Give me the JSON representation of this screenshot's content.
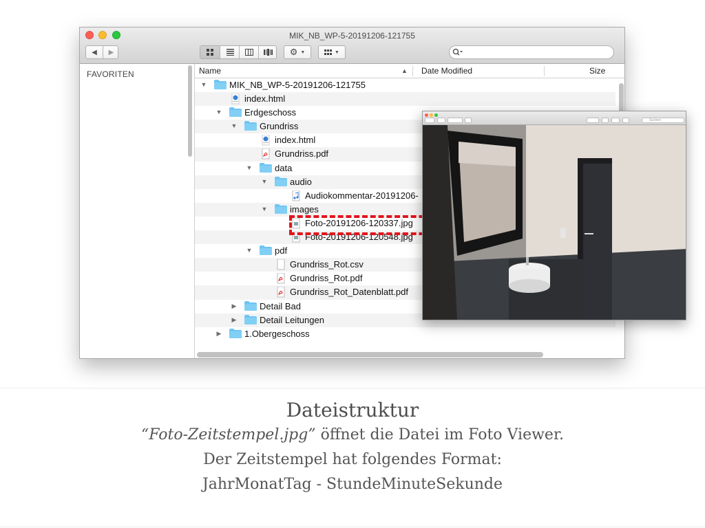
{
  "window": {
    "title": "MIK_NB_WP-5-20191206-121755",
    "search_placeholder": ""
  },
  "sidebar": {
    "heading": "FAVORITEN"
  },
  "columns": {
    "name": "Name",
    "date_modified": "Date Modified",
    "size": "Size"
  },
  "files": [
    {
      "name": "MIK_NB_WP-5-20191206-121755",
      "level": 0,
      "kind": "folder",
      "disclosure": "open"
    },
    {
      "name": "index.html",
      "level": 1,
      "kind": "html",
      "disclosure": "none"
    },
    {
      "name": "Erdgeschoss",
      "level": 1,
      "kind": "folder",
      "disclosure": "open"
    },
    {
      "name": "Grundriss",
      "level": 2,
      "kind": "folder",
      "disclosure": "open"
    },
    {
      "name": "index.html",
      "level": 3,
      "kind": "html",
      "disclosure": "none"
    },
    {
      "name": "Grundriss.pdf",
      "level": 3,
      "kind": "pdf",
      "disclosure": "none"
    },
    {
      "name": "data",
      "level": 3,
      "kind": "folder",
      "disclosure": "open"
    },
    {
      "name": "audio",
      "level": 4,
      "kind": "folder",
      "disclosure": "open"
    },
    {
      "name": "Audiokommentar-20191206-",
      "level": 5,
      "kind": "audio",
      "disclosure": "none"
    },
    {
      "name": "images",
      "level": 4,
      "kind": "folder",
      "disclosure": "open"
    },
    {
      "name": "Foto-20191206-120337.jpg",
      "level": 5,
      "kind": "image",
      "disclosure": "none"
    },
    {
      "name": "Foto-20191206-120548.jpg",
      "level": 5,
      "kind": "image",
      "disclosure": "none"
    },
    {
      "name": "pdf",
      "level": 3,
      "kind": "folder",
      "disclosure": "open"
    },
    {
      "name": "Grundriss_Rot.csv",
      "level": 4,
      "kind": "csv",
      "disclosure": "none"
    },
    {
      "name": "Grundriss_Rot.pdf",
      "level": 4,
      "kind": "pdf",
      "disclosure": "none"
    },
    {
      "name": "Grundriss_Rot_Datenblatt.pdf",
      "level": 4,
      "kind": "pdf",
      "disclosure": "none"
    },
    {
      "name": "Detail Bad",
      "level": 2,
      "kind": "folder",
      "disclosure": "closed"
    },
    {
      "name": "Detail Leitungen",
      "level": 2,
      "kind": "folder",
      "disclosure": "closed"
    },
    {
      "name": "1.Obergeschoss",
      "level": 1,
      "kind": "folder",
      "disclosure": "closed"
    }
  ],
  "viewer": {
    "search_placeholder": "Suchen"
  },
  "colors": {
    "highlight": "#e3141b",
    "folder": "#6fc4f3",
    "traffic_close": "#fc5f57",
    "traffic_minimize": "#fdbb2e",
    "traffic_zoom": "#2ac840"
  },
  "caption": {
    "title": "Dateistruktur",
    "line1_quoted": "“Foto-Zeitstempel.jpg”",
    "line1_rest": " öffnet die Datei im Foto Viewer.",
    "line2": "Der Zeitstempel hat folgendes Format:",
    "line3": "JahrMonatTag - StundeMinuteSekunde"
  }
}
